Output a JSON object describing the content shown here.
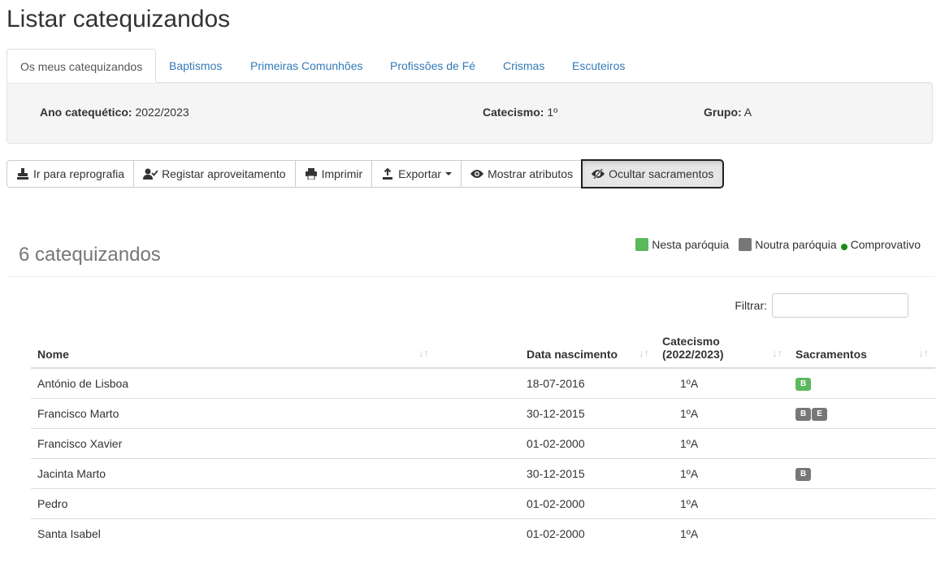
{
  "page": {
    "title": "Listar catequizandos"
  },
  "tabs": [
    {
      "label": "Os meus catequizandos",
      "active": true
    },
    {
      "label": "Baptismos"
    },
    {
      "label": "Primeiras Comunhões"
    },
    {
      "label": "Profissões de Fé"
    },
    {
      "label": "Crismas"
    },
    {
      "label": "Escuteiros"
    }
  ],
  "info": {
    "ano_label": "Ano catequético:",
    "ano_value": "2022/2023",
    "catecismo_label": "Catecismo:",
    "catecismo_value": "1º",
    "grupo_label": "Grupo:",
    "grupo_value": "A"
  },
  "toolbar": {
    "reprografia": "Ir para reprografia",
    "aproveitamento": "Registar aproveitamento",
    "imprimir": "Imprimir",
    "exportar": "Exportar",
    "atributos": "Mostrar atributos",
    "sacramentos": "Ocultar sacramentos"
  },
  "summary": {
    "count_title": "6 catequizandos"
  },
  "legend": {
    "nesta": "Nesta paróquia",
    "noutra": "Noutra paróquia",
    "comprovativo": "Comprovativo"
  },
  "colors": {
    "nesta": "#5cb85c",
    "noutra": "#777777",
    "comprovativo": "#1a8a1a",
    "link": "#337ab7"
  },
  "filter": {
    "label": "Filtrar:",
    "value": ""
  },
  "table": {
    "headers": {
      "nome": "Nome",
      "data": "Data nascimento",
      "catecismo_line1": "Catecismo",
      "catecismo_line2": "(2022/2023)",
      "sacramentos": "Sacramentos"
    },
    "rows": [
      {
        "nome": "António de Lisboa",
        "data": "18-07-2016",
        "catecismo": "1ºA",
        "badges": [
          {
            "text": "B",
            "kind": "nesta"
          }
        ]
      },
      {
        "nome": "Francisco Marto",
        "data": "30-12-2015",
        "catecismo": "1ºA",
        "badges": [
          {
            "text": "B",
            "kind": "noutra"
          },
          {
            "text": "E",
            "kind": "noutra"
          }
        ]
      },
      {
        "nome": "Francisco Xavier",
        "data": "01-02-2000",
        "catecismo": "1ºA",
        "badges": []
      },
      {
        "nome": "Jacinta Marto",
        "data": "30-12-2015",
        "catecismo": "1ºA",
        "badges": [
          {
            "text": "B",
            "kind": "noutra"
          }
        ]
      },
      {
        "nome": "Pedro",
        "data": "01-02-2000",
        "catecismo": "1ºA",
        "badges": []
      },
      {
        "nome": "Santa Isabel",
        "data": "01-02-2000",
        "catecismo": "1ºA",
        "badges": []
      }
    ]
  }
}
